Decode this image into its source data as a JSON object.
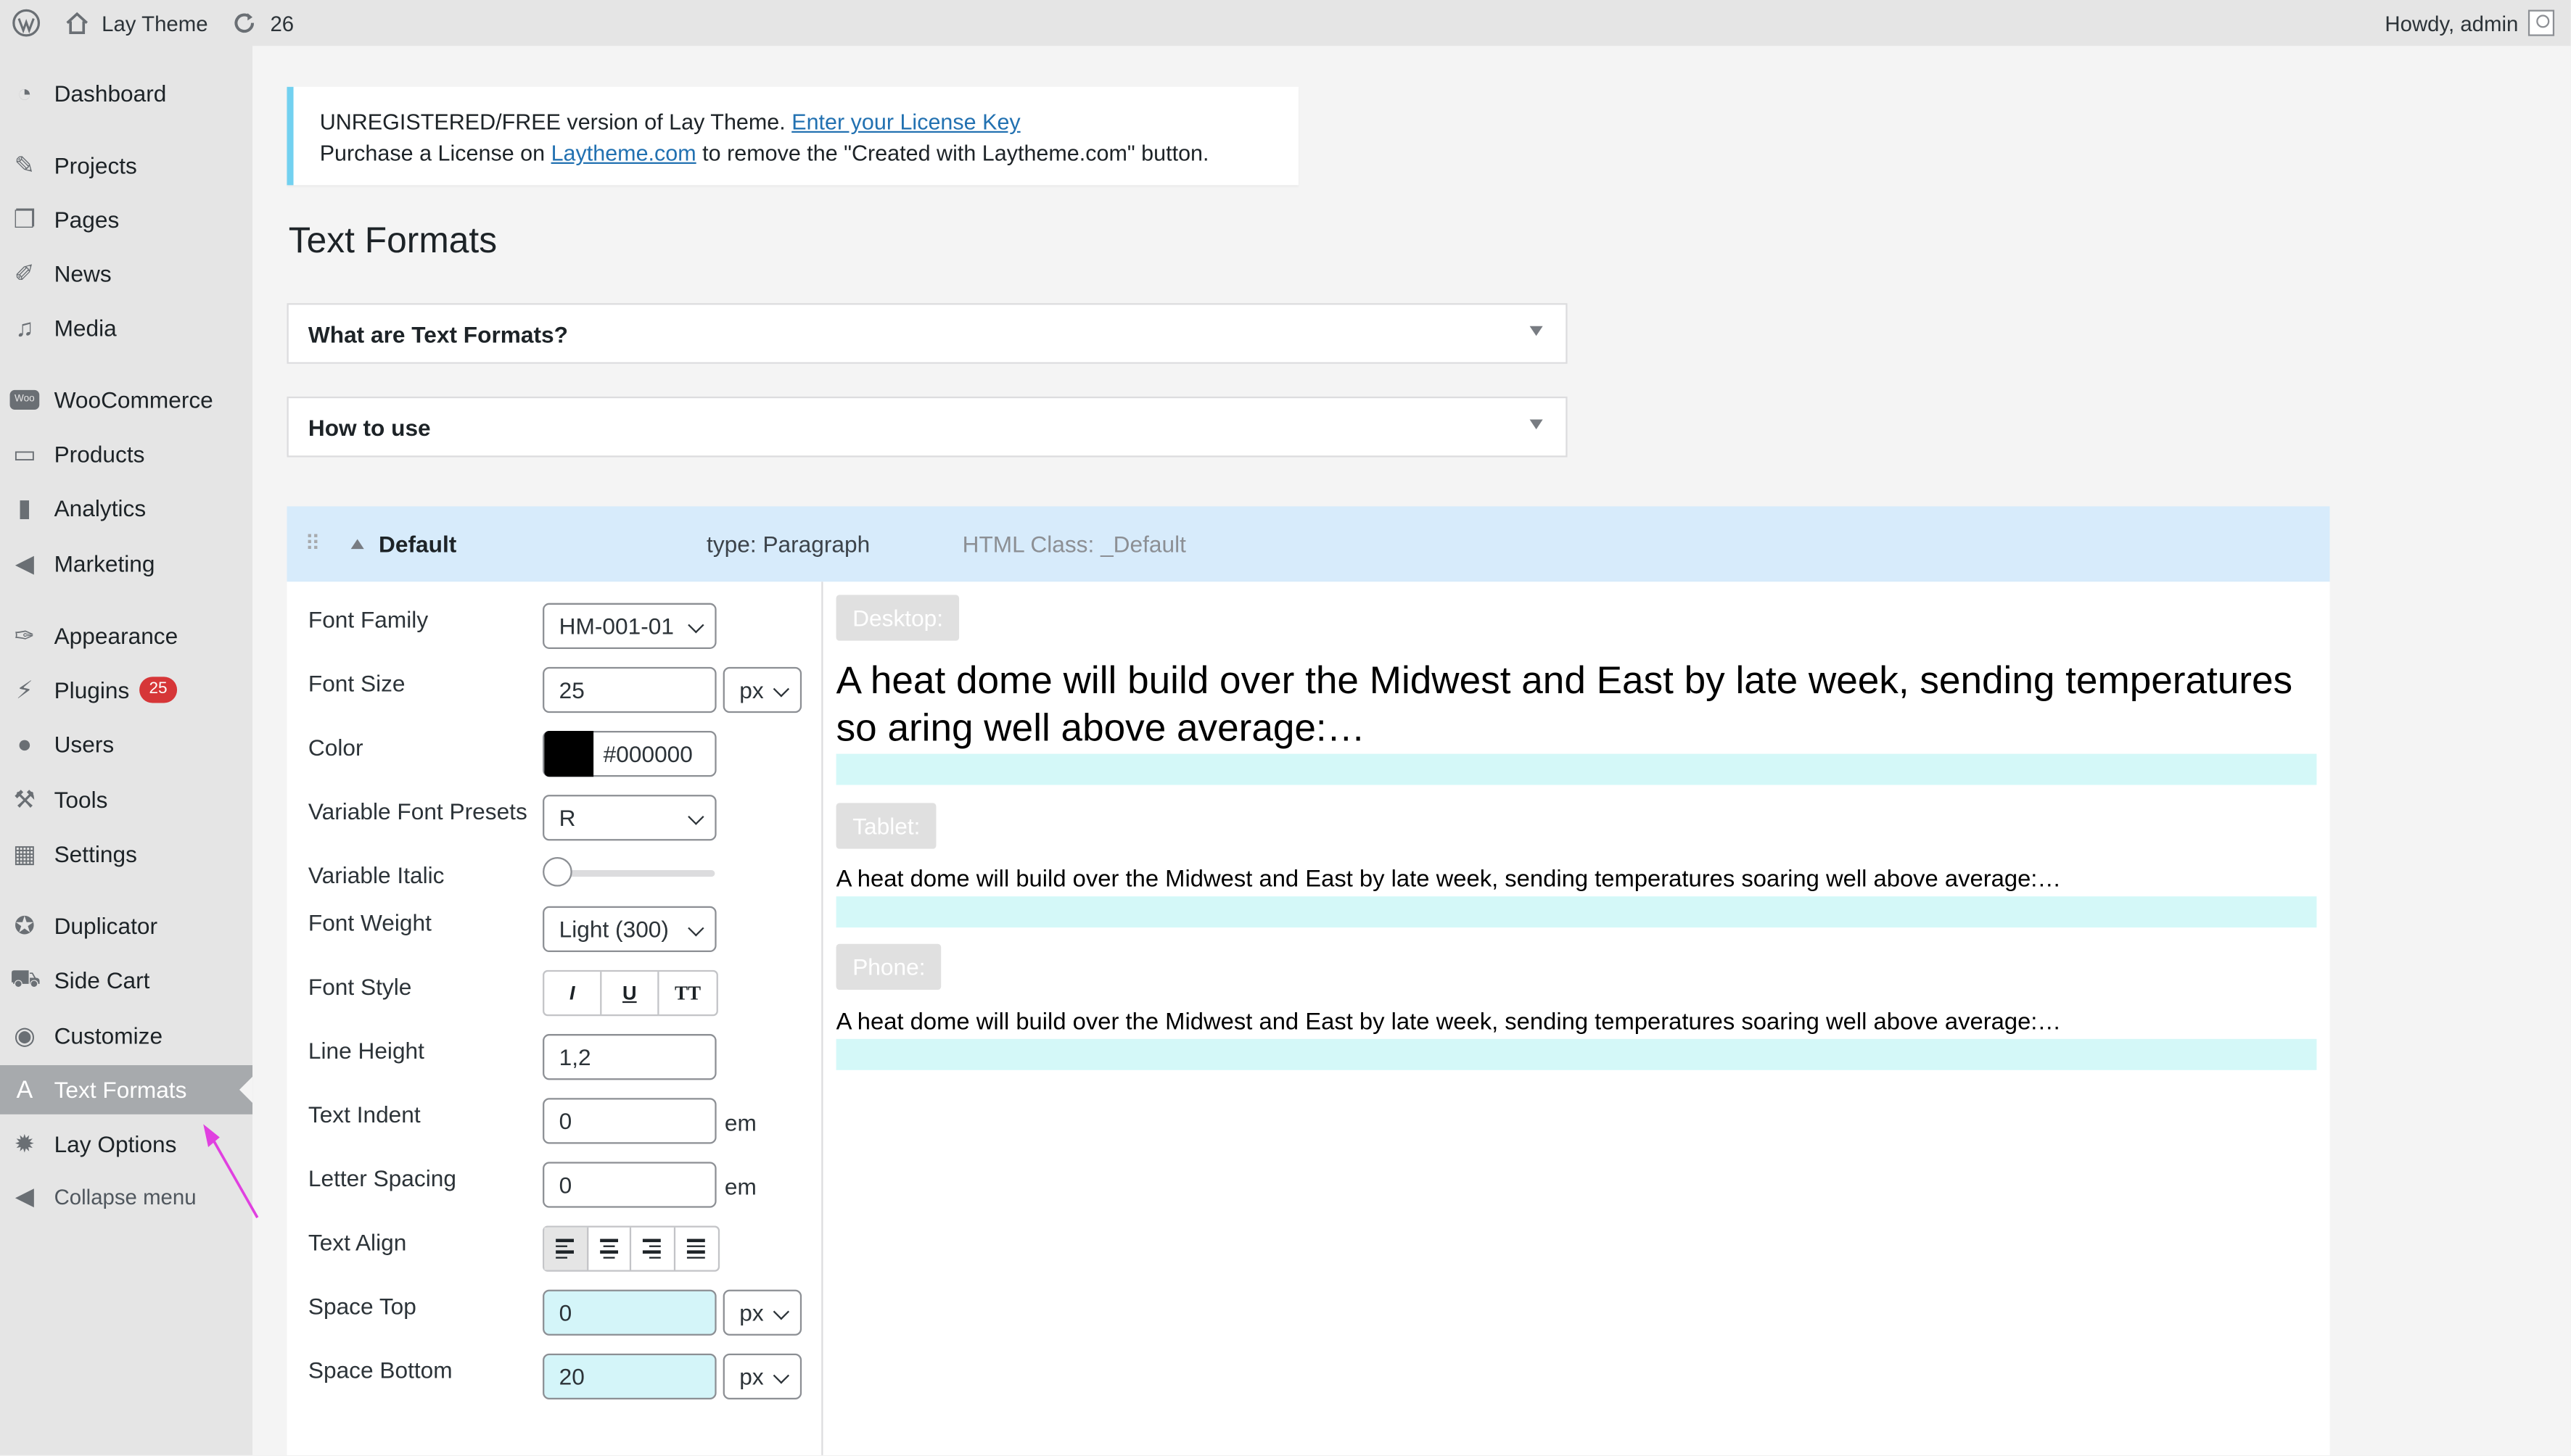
{
  "adminbar": {
    "site_name": "Lay Theme",
    "updates_count": "26",
    "howdy": "Howdy, admin"
  },
  "sidebar": {
    "items": [
      {
        "label": "Dashboard",
        "icon": "dashboard-icon"
      },
      {
        "label": "Projects",
        "icon": "pin-icon"
      },
      {
        "label": "Pages",
        "icon": "pages-icon"
      },
      {
        "label": "News",
        "icon": "edit-icon"
      },
      {
        "label": "Media",
        "icon": "media-icon"
      },
      {
        "label": "WooCommerce",
        "icon": "woo-icon"
      },
      {
        "label": "Products",
        "icon": "archive-icon"
      },
      {
        "label": "Analytics",
        "icon": "bar-chart-icon"
      },
      {
        "label": "Marketing",
        "icon": "megaphone-icon"
      },
      {
        "label": "Appearance",
        "icon": "brush-icon"
      },
      {
        "label": "Plugins",
        "icon": "plugin-icon",
        "badge": "25"
      },
      {
        "label": "Users",
        "icon": "user-icon"
      },
      {
        "label": "Tools",
        "icon": "wrench-icon"
      },
      {
        "label": "Settings",
        "icon": "settings-icon"
      },
      {
        "label": "Duplicator",
        "icon": "duplicator-icon"
      },
      {
        "label": "Side Cart",
        "icon": "cart-icon"
      },
      {
        "label": "Customize",
        "icon": "eye-icon"
      },
      {
        "label": "Text Formats",
        "icon": "text-a-icon",
        "active": true
      },
      {
        "label": "Lay Options",
        "icon": "gear-icon"
      }
    ],
    "collapse_label": "Collapse menu"
  },
  "notice": {
    "line1_prefix": "UNREGISTERED/FREE version of Lay Theme. ",
    "line1_link": "Enter your License Key",
    "line2_prefix": "Purchase a License on ",
    "line2_link": "Laytheme.com",
    "line2_suffix": " to remove the \"Created with Laytheme.com\" button."
  },
  "page_title": "Text Formats",
  "accordions": [
    {
      "label": "What are Text Formats?"
    },
    {
      "label": "How to use"
    }
  ],
  "format": {
    "name": "Default",
    "type": "type: Paragraph",
    "html_class": "HTML Class: _Default"
  },
  "settings": {
    "font_family": {
      "label": "Font Family",
      "value": "HM-001-01"
    },
    "font_size": {
      "label": "Font Size",
      "value": "25",
      "unit": "px"
    },
    "color": {
      "label": "Color",
      "value": "#000000"
    },
    "variable_presets": {
      "label": "Variable Font Presets",
      "value": "R"
    },
    "variable_italic": {
      "label": "Variable Italic",
      "level": 0
    },
    "font_weight": {
      "label": "Font Weight",
      "value": "Light (300)"
    },
    "font_style": {
      "label": "Font Style",
      "buttons": [
        "I",
        "U",
        "TT"
      ]
    },
    "line_height": {
      "label": "Line Height",
      "value": "1,2"
    },
    "text_indent": {
      "label": "Text Indent",
      "value": "0",
      "unit": "em"
    },
    "letter_spacing": {
      "label": "Letter Spacing",
      "value": "0",
      "unit": "em"
    },
    "text_align": {
      "label": "Text Align",
      "selected": "left"
    },
    "space_top": {
      "label": "Space Top",
      "value": "0",
      "unit": "px"
    },
    "space_bottom": {
      "label": "Space Bottom",
      "value": "20",
      "unit": "px"
    }
  },
  "preview": {
    "desktop_label": "Desktop:",
    "tablet_label": "Tablet:",
    "phone_label": "Phone:",
    "desktop_text": "A heat dome will build over the Midwest and East by late week, sending temperatures so aring well above average:…",
    "tablet_text": "A heat dome will build over the Midwest and East by late week, sending temperatures soaring well above average:…",
    "phone_text": "A heat dome will build over the Midwest and East by late week, sending temperatures soaring well above average:…"
  },
  "colors": {
    "accent_bar": "#d4f8f8",
    "header_bg": "#d7ebfb",
    "annotation_arrow": "#e040e0"
  }
}
